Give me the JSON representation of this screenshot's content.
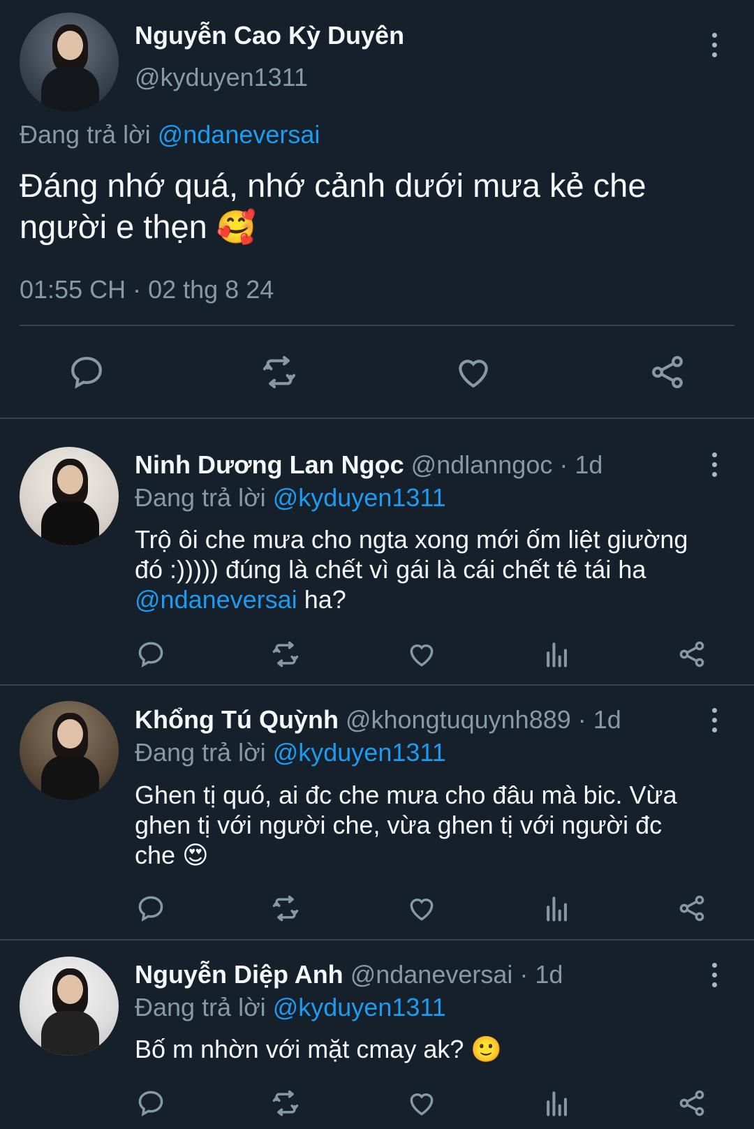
{
  "main_tweet": {
    "author_name": "Nguyễn Cao Kỳ Duyên",
    "author_handle": "@kyduyen1311",
    "replying_prefix": "Đang trả lời",
    "replying_to": "@ndaneversai",
    "text_line1": "Đáng nhớ quá, nhớ cảnh dưới mưa kẻ che",
    "text_line2": "người e thẹn",
    "emoji": "🥰",
    "timestamp": "01:55 CH · 02 thg 8 24"
  },
  "replies": [
    {
      "author_name": "Ninh Dương Lan Ngọc",
      "author_handle": "@ndlanngoc",
      "time": "· 1d",
      "replying_prefix": "Đang trả lời",
      "replying_to": "@kyduyen1311",
      "text_line1": "Trộ ôi che mưa cho ngta xong mới ốm liệt giường",
      "text_line2": "đó :))))) đúng là chết vì gái là cái chết tê tái ha",
      "text_line3_mention": "@ndaneversai",
      "text_line3_rest": " ha?"
    },
    {
      "author_name": "Khổng Tú Quỳnh",
      "author_handle": "@khongtuquynh889",
      "time": "· 1d",
      "replying_prefix": "Đang trả lời",
      "replying_to": "@kyduyen1311",
      "text_line1": "Ghen tị quó, ai đc che mưa cho đâu mà bic. Vừa",
      "text_line2": "ghen tị với người che, vừa ghen tị với người đc",
      "text_line3": "che",
      "emoji": "😍"
    },
    {
      "author_name": "Nguyễn Diệp Anh",
      "author_handle": "@ndaneversai",
      "time": "· 1d",
      "replying_prefix": "Đang trả lời",
      "replying_to": "@kyduyen1311",
      "text_line1": "Bố m nhờn với mặt cmay ak?",
      "emoji": "🙂"
    }
  ],
  "icons": {
    "reply": "reply-icon",
    "retweet": "retweet-icon",
    "like": "heart-icon",
    "views": "views-icon",
    "share": "share-icon",
    "more": "more-vertical-icon"
  },
  "colors": {
    "background": "#15202b",
    "accent": "#1d9bf0",
    "muted": "#8899a6",
    "divider": "#38444d"
  }
}
